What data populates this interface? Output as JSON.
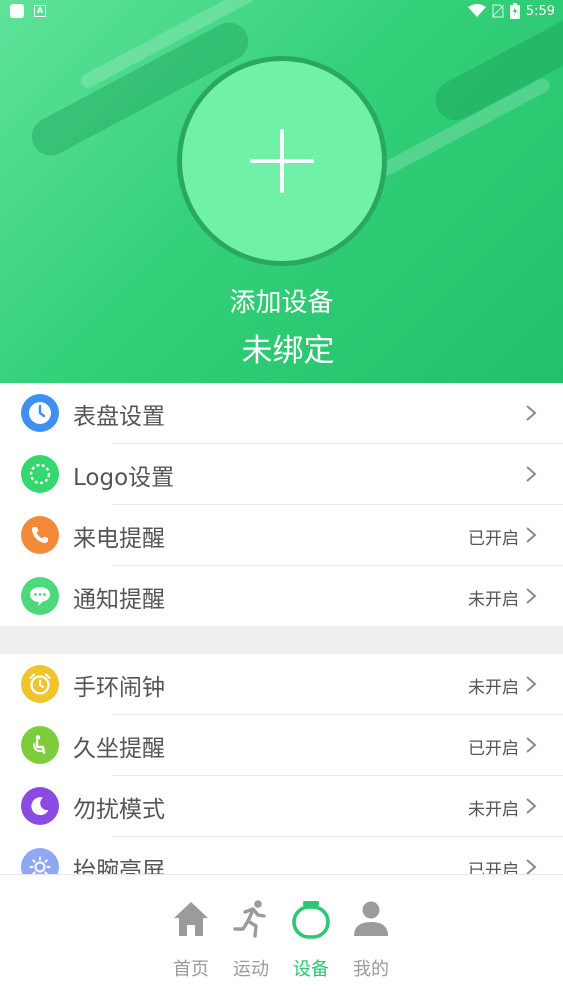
{
  "status_bar": {
    "time": "5:59"
  },
  "header": {
    "add_device_label": "添加设备",
    "bind_status": "未绑定"
  },
  "colors": {
    "accent": "#2dc673",
    "header_green": "#34d07a",
    "icon_blue": "#3f8ff0",
    "icon_green": "#34d86f",
    "icon_orange": "#f28a3a",
    "icon_lightgreen": "#4cd97a",
    "icon_yellow": "#f0c52c",
    "icon_lime": "#7ccc3b",
    "icon_purple": "#8b4be3",
    "icon_lavender": "#8fa8f3"
  },
  "settings_group_1": [
    {
      "label": "表盘设置",
      "state": "",
      "icon": "clock-icon"
    },
    {
      "label": "Logo设置",
      "state": "",
      "icon": "logo-ring-icon"
    },
    {
      "label": "来电提醒",
      "state": "已开启",
      "icon": "phone-icon"
    },
    {
      "label": "通知提醒",
      "state": "未开启",
      "icon": "message-icon"
    }
  ],
  "settings_group_2": [
    {
      "label": "手环闹钟",
      "state": "未开启",
      "icon": "alarm-clock-icon"
    },
    {
      "label": "久坐提醒",
      "state": "已开启",
      "icon": "sitting-person-icon"
    },
    {
      "label": "勿扰模式",
      "state": "未开启",
      "icon": "moon-icon"
    },
    {
      "label": "抬腕亮屏",
      "state": "已开启",
      "icon": "sun-icon"
    }
  ],
  "tabs": [
    {
      "label": "首页",
      "icon": "home-icon",
      "active": false
    },
    {
      "label": "运动",
      "icon": "running-icon",
      "active": false
    },
    {
      "label": "设备",
      "icon": "band-icon",
      "active": true
    },
    {
      "label": "我的",
      "icon": "person-icon",
      "active": false
    }
  ]
}
